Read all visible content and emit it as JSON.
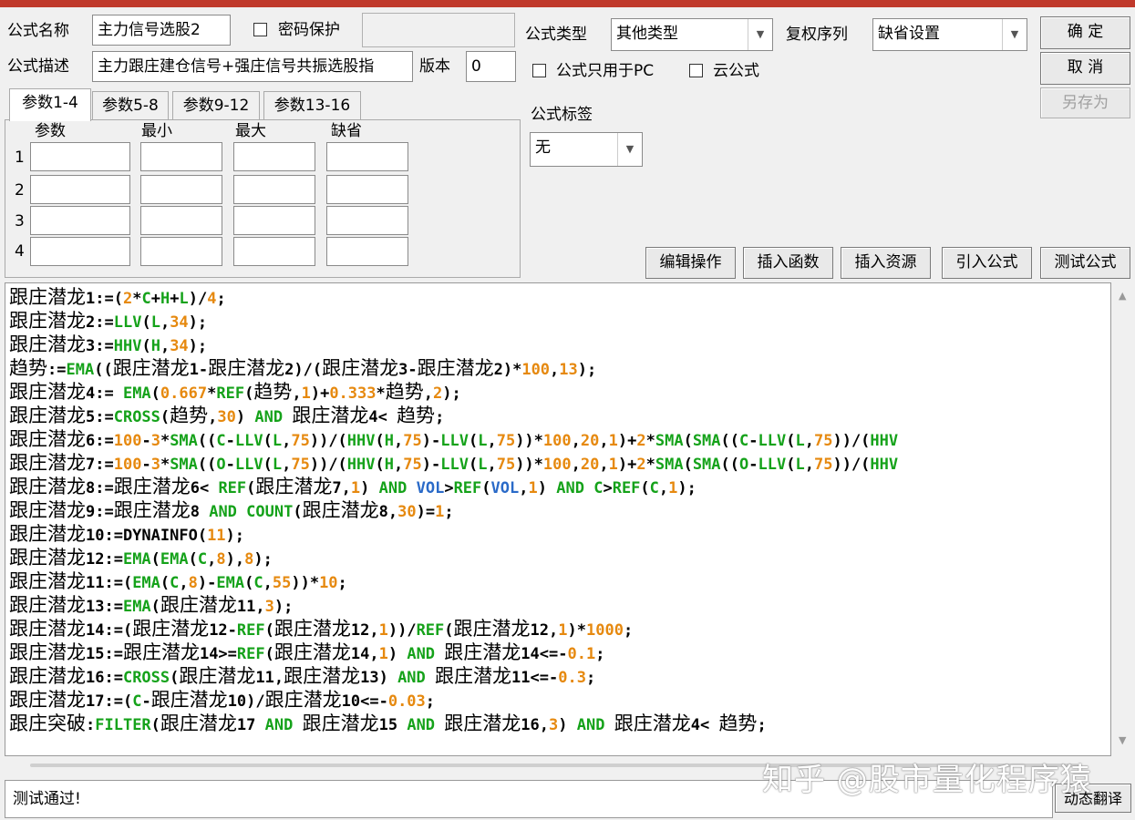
{
  "header": {
    "formula_name_label": "公式名称",
    "formula_name_value": "主力信号选股2",
    "password_label": "密码保护",
    "password_checked": false,
    "formula_desc_label": "公式描述",
    "formula_desc_value": "主力跟庄建仓信号+强庄信号共振选股指",
    "version_label": "版本",
    "version_value": "0",
    "formula_type_label": "公式类型",
    "formula_type_value": "其他类型",
    "rights_label": "复权序列",
    "rights_value": "缺省设置",
    "pc_only_label": "公式只用于PC",
    "pc_only_checked": false,
    "cloud_label": "云公式",
    "cloud_checked": false,
    "tag_label": "公式标签",
    "tag_value": "无"
  },
  "buttons": {
    "ok": "确 定",
    "cancel": "取 消",
    "save_as": "另存为",
    "edit_ops": "编辑操作",
    "insert_func": "插入函数",
    "insert_res": "插入资源",
    "import_formula": "引入公式",
    "test_formula": "测试公式",
    "dynamic_translate": "动态翻译"
  },
  "params": {
    "tabs": [
      "参数1-4",
      "参数5-8",
      "参数9-12",
      "参数13-16"
    ],
    "active_tab": 0,
    "columns": [
      "参数",
      "最小",
      "最大",
      "缺省"
    ],
    "rows": [
      "1",
      "2",
      "3",
      "4"
    ]
  },
  "code_lines": [
    [
      [
        "跟庄潜龙",
        "t"
      ],
      [
        "1:=(",
        ""
      ],
      [
        "2",
        "n"
      ],
      [
        "*",
        ""
      ],
      [
        "C",
        "f"
      ],
      [
        "+",
        ""
      ],
      [
        "H",
        "f"
      ],
      [
        "+",
        ""
      ],
      [
        "L",
        "f"
      ],
      [
        ")/",
        ""
      ],
      [
        "4",
        "n"
      ],
      [
        ";",
        ""
      ]
    ],
    [
      [
        "跟庄潜龙",
        "t"
      ],
      [
        "2:=",
        ""
      ],
      [
        "LLV",
        "f"
      ],
      [
        "(",
        ""
      ],
      [
        "L",
        "f"
      ],
      [
        ",",
        ""
      ],
      [
        "34",
        "n"
      ],
      [
        ");",
        ""
      ]
    ],
    [
      [
        "跟庄潜龙",
        "t"
      ],
      [
        "3:=",
        ""
      ],
      [
        "HHV",
        "f"
      ],
      [
        "(",
        ""
      ],
      [
        "H",
        "f"
      ],
      [
        ",",
        ""
      ],
      [
        "34",
        "n"
      ],
      [
        ");",
        ""
      ]
    ],
    [
      [
        "趋势",
        "t"
      ],
      [
        ":=",
        ""
      ],
      [
        "EMA",
        "f"
      ],
      [
        "((",
        ""
      ],
      [
        "跟庄潜龙",
        "t"
      ],
      [
        "1-",
        ""
      ],
      [
        "跟庄潜龙",
        "t"
      ],
      [
        "2)/(",
        ""
      ],
      [
        "跟庄潜龙",
        "t"
      ],
      [
        "3-",
        ""
      ],
      [
        "跟庄潜龙",
        "t"
      ],
      [
        "2)*",
        ""
      ],
      [
        "100",
        "n"
      ],
      [
        ",",
        ""
      ],
      [
        "13",
        "n"
      ],
      [
        ");",
        ""
      ]
    ],
    [
      [
        "跟庄潜龙",
        "t"
      ],
      [
        "4:= ",
        ""
      ],
      [
        "EMA",
        "f"
      ],
      [
        "(",
        ""
      ],
      [
        "0.667",
        "n"
      ],
      [
        "*",
        ""
      ],
      [
        "REF",
        "f"
      ],
      [
        "(",
        ""
      ],
      [
        "趋势",
        "t"
      ],
      [
        ",",
        ""
      ],
      [
        "1",
        "n"
      ],
      [
        ")+",
        ""
      ],
      [
        "0.333",
        "n"
      ],
      [
        "*",
        ""
      ],
      [
        "趋势",
        "t"
      ],
      [
        ",",
        ""
      ],
      [
        "2",
        "n"
      ],
      [
        ");",
        ""
      ]
    ],
    [
      [
        "跟庄潜龙",
        "t"
      ],
      [
        "5:=",
        ""
      ],
      [
        "CROSS",
        "f"
      ],
      [
        "(",
        ""
      ],
      [
        "趋势",
        "t"
      ],
      [
        ",",
        ""
      ],
      [
        "30",
        "n"
      ],
      [
        ") ",
        ""
      ],
      [
        "AND",
        "k"
      ],
      [
        " ",
        ""
      ],
      [
        "跟庄潜龙",
        "t"
      ],
      [
        "4< ",
        ""
      ],
      [
        "趋势",
        "t"
      ],
      [
        ";",
        ""
      ]
    ],
    [
      [
        "跟庄潜龙",
        "t"
      ],
      [
        "6:=",
        ""
      ],
      [
        "100",
        "n"
      ],
      [
        "-",
        ""
      ],
      [
        "3",
        "n"
      ],
      [
        "*",
        ""
      ],
      [
        "SMA",
        "f"
      ],
      [
        "((",
        ""
      ],
      [
        "C",
        "f"
      ],
      [
        "-",
        ""
      ],
      [
        "LLV",
        "f"
      ],
      [
        "(",
        ""
      ],
      [
        "L",
        "f"
      ],
      [
        ",",
        ""
      ],
      [
        "75",
        "n"
      ],
      [
        "))/(",
        ""
      ],
      [
        "HHV",
        "f"
      ],
      [
        "(",
        ""
      ],
      [
        "H",
        "f"
      ],
      [
        ",",
        ""
      ],
      [
        "75",
        "n"
      ],
      [
        ")-",
        ""
      ],
      [
        "LLV",
        "f"
      ],
      [
        "(",
        ""
      ],
      [
        "L",
        "f"
      ],
      [
        ",",
        ""
      ],
      [
        "75",
        "n"
      ],
      [
        "))*",
        ""
      ],
      [
        "100",
        "n"
      ],
      [
        ",",
        ""
      ],
      [
        "20",
        "n"
      ],
      [
        ",",
        ""
      ],
      [
        "1",
        "n"
      ],
      [
        ")+",
        ""
      ],
      [
        "2",
        "n"
      ],
      [
        "*",
        ""
      ],
      [
        "SMA",
        "f"
      ],
      [
        "(",
        ""
      ],
      [
        "SMA",
        "f"
      ],
      [
        "((",
        ""
      ],
      [
        "C",
        "f"
      ],
      [
        "-",
        ""
      ],
      [
        "LLV",
        "f"
      ],
      [
        "(",
        ""
      ],
      [
        "L",
        "f"
      ],
      [
        ",",
        ""
      ],
      [
        "75",
        "n"
      ],
      [
        "))/(",
        ""
      ],
      [
        "HHV",
        "f"
      ]
    ],
    [
      [
        "跟庄潜龙",
        "t"
      ],
      [
        "7:=",
        ""
      ],
      [
        "100",
        "n"
      ],
      [
        "-",
        ""
      ],
      [
        "3",
        "n"
      ],
      [
        "*",
        ""
      ],
      [
        "SMA",
        "f"
      ],
      [
        "((",
        ""
      ],
      [
        "O",
        "f"
      ],
      [
        "-",
        ""
      ],
      [
        "LLV",
        "f"
      ],
      [
        "(",
        ""
      ],
      [
        "L",
        "f"
      ],
      [
        ",",
        ""
      ],
      [
        "75",
        "n"
      ],
      [
        "))/(",
        ""
      ],
      [
        "HHV",
        "f"
      ],
      [
        "(",
        ""
      ],
      [
        "H",
        "f"
      ],
      [
        ",",
        ""
      ],
      [
        "75",
        "n"
      ],
      [
        ")-",
        ""
      ],
      [
        "LLV",
        "f"
      ],
      [
        "(",
        ""
      ],
      [
        "L",
        "f"
      ],
      [
        ",",
        ""
      ],
      [
        "75",
        "n"
      ],
      [
        "))*",
        ""
      ],
      [
        "100",
        "n"
      ],
      [
        ",",
        ""
      ],
      [
        "20",
        "n"
      ],
      [
        ",",
        ""
      ],
      [
        "1",
        "n"
      ],
      [
        ")+",
        ""
      ],
      [
        "2",
        "n"
      ],
      [
        "*",
        ""
      ],
      [
        "SMA",
        "f"
      ],
      [
        "(",
        ""
      ],
      [
        "SMA",
        "f"
      ],
      [
        "((",
        ""
      ],
      [
        "O",
        "f"
      ],
      [
        "-",
        ""
      ],
      [
        "LLV",
        "f"
      ],
      [
        "(",
        ""
      ],
      [
        "L",
        "f"
      ],
      [
        ",",
        ""
      ],
      [
        "75",
        "n"
      ],
      [
        "))/(",
        ""
      ],
      [
        "HHV",
        "f"
      ]
    ],
    [
      [
        "跟庄潜龙",
        "t"
      ],
      [
        "8:=",
        ""
      ],
      [
        "跟庄潜龙",
        "t"
      ],
      [
        "6< ",
        ""
      ],
      [
        "REF",
        "f"
      ],
      [
        "(",
        ""
      ],
      [
        "跟庄潜龙",
        "t"
      ],
      [
        "7,",
        ""
      ],
      [
        "1",
        "n"
      ],
      [
        ") ",
        ""
      ],
      [
        "AND",
        "k"
      ],
      [
        " ",
        ""
      ],
      [
        "VOL",
        "v"
      ],
      [
        ">",
        ""
      ],
      [
        "REF",
        "f"
      ],
      [
        "(",
        ""
      ],
      [
        "VOL",
        "v"
      ],
      [
        ",",
        ""
      ],
      [
        "1",
        "n"
      ],
      [
        ") ",
        ""
      ],
      [
        "AND",
        "k"
      ],
      [
        " ",
        ""
      ],
      [
        "C",
        "f"
      ],
      [
        ">",
        ""
      ],
      [
        "REF",
        "f"
      ],
      [
        "(",
        ""
      ],
      [
        "C",
        "f"
      ],
      [
        ",",
        ""
      ],
      [
        "1",
        "n"
      ],
      [
        ");",
        ""
      ]
    ],
    [
      [
        "跟庄潜龙",
        "t"
      ],
      [
        "9:=",
        ""
      ],
      [
        "跟庄潜龙",
        "t"
      ],
      [
        "8 ",
        ""
      ],
      [
        "AND",
        "k"
      ],
      [
        " ",
        ""
      ],
      [
        "COUNT",
        "f"
      ],
      [
        "(",
        ""
      ],
      [
        "跟庄潜龙",
        "t"
      ],
      [
        "8,",
        ""
      ],
      [
        "30",
        "n"
      ],
      [
        ")=",
        ""
      ],
      [
        "1",
        "n"
      ],
      [
        ";",
        ""
      ]
    ],
    [
      [
        "跟庄潜龙",
        "t"
      ],
      [
        "10:=DYNAINFO(",
        ""
      ],
      [
        "11",
        "n"
      ],
      [
        ");",
        ""
      ]
    ],
    [
      [
        "跟庄潜龙",
        "t"
      ],
      [
        "12:=",
        ""
      ],
      [
        "EMA",
        "f"
      ],
      [
        "(",
        ""
      ],
      [
        "EMA",
        "f"
      ],
      [
        "(",
        ""
      ],
      [
        "C",
        "f"
      ],
      [
        ",",
        ""
      ],
      [
        "8",
        "n"
      ],
      [
        "),",
        ""
      ],
      [
        "8",
        "n"
      ],
      [
        ");",
        ""
      ]
    ],
    [
      [
        "跟庄潜龙",
        "t"
      ],
      [
        "11:=(",
        ""
      ],
      [
        "EMA",
        "f"
      ],
      [
        "(",
        ""
      ],
      [
        "C",
        "f"
      ],
      [
        ",",
        ""
      ],
      [
        "8",
        "n"
      ],
      [
        ")-",
        ""
      ],
      [
        "EMA",
        "f"
      ],
      [
        "(",
        ""
      ],
      [
        "C",
        "f"
      ],
      [
        ",",
        ""
      ],
      [
        "55",
        "n"
      ],
      [
        "))*",
        ""
      ],
      [
        "10",
        "n"
      ],
      [
        ";",
        ""
      ]
    ],
    [
      [
        "跟庄潜龙",
        "t"
      ],
      [
        "13:=",
        ""
      ],
      [
        "EMA",
        "f"
      ],
      [
        "(",
        ""
      ],
      [
        "跟庄潜龙",
        "t"
      ],
      [
        "11,",
        ""
      ],
      [
        "3",
        "n"
      ],
      [
        ");",
        ""
      ]
    ],
    [
      [
        "跟庄潜龙",
        "t"
      ],
      [
        "14:=(",
        ""
      ],
      [
        "跟庄潜龙",
        "t"
      ],
      [
        "12-",
        ""
      ],
      [
        "REF",
        "f"
      ],
      [
        "(",
        ""
      ],
      [
        "跟庄潜龙",
        "t"
      ],
      [
        "12,",
        ""
      ],
      [
        "1",
        "n"
      ],
      [
        "))/",
        ""
      ],
      [
        "REF",
        "f"
      ],
      [
        "(",
        ""
      ],
      [
        "跟庄潜龙",
        "t"
      ],
      [
        "12,",
        ""
      ],
      [
        "1",
        "n"
      ],
      [
        ")*",
        ""
      ],
      [
        "1000",
        "n"
      ],
      [
        ";",
        ""
      ]
    ],
    [
      [
        "跟庄潜龙",
        "t"
      ],
      [
        "15:=",
        ""
      ],
      [
        "跟庄潜龙",
        "t"
      ],
      [
        "14>=",
        ""
      ],
      [
        "REF",
        "f"
      ],
      [
        "(",
        ""
      ],
      [
        "跟庄潜龙",
        "t"
      ],
      [
        "14,",
        ""
      ],
      [
        "1",
        "n"
      ],
      [
        ") ",
        ""
      ],
      [
        "AND",
        "k"
      ],
      [
        " ",
        ""
      ],
      [
        "跟庄潜龙",
        "t"
      ],
      [
        "14<=-",
        ""
      ],
      [
        "0.1",
        "n"
      ],
      [
        ";",
        ""
      ]
    ],
    [
      [
        "跟庄潜龙",
        "t"
      ],
      [
        "16:=",
        ""
      ],
      [
        "CROSS",
        "f"
      ],
      [
        "(",
        ""
      ],
      [
        "跟庄潜龙",
        "t"
      ],
      [
        "11,",
        ""
      ],
      [
        "跟庄潜龙",
        "t"
      ],
      [
        "13) ",
        ""
      ],
      [
        "AND",
        "k"
      ],
      [
        " ",
        ""
      ],
      [
        "跟庄潜龙",
        "t"
      ],
      [
        "11<=-",
        ""
      ],
      [
        "0.3",
        "n"
      ],
      [
        ";",
        ""
      ]
    ],
    [
      [
        "跟庄潜龙",
        "t"
      ],
      [
        "17:=(",
        ""
      ],
      [
        "C",
        "f"
      ],
      [
        "-",
        ""
      ],
      [
        "跟庄潜龙",
        "t"
      ],
      [
        "10)/",
        ""
      ],
      [
        "跟庄潜龙",
        "t"
      ],
      [
        "10<=-",
        ""
      ],
      [
        "0.03",
        "n"
      ],
      [
        ";",
        ""
      ]
    ],
    [
      [
        "跟庄突破",
        "t"
      ],
      [
        ":",
        ""
      ],
      [
        "FILTER",
        "f"
      ],
      [
        "(",
        ""
      ],
      [
        "跟庄潜龙",
        "t"
      ],
      [
        "17 ",
        ""
      ],
      [
        "AND",
        "k"
      ],
      [
        " ",
        ""
      ],
      [
        "跟庄潜龙",
        "t"
      ],
      [
        "15 ",
        ""
      ],
      [
        "AND",
        "k"
      ],
      [
        " ",
        ""
      ],
      [
        "跟庄潜龙",
        "t"
      ],
      [
        "16,",
        ""
      ],
      [
        "3",
        "n"
      ],
      [
        ") ",
        ""
      ],
      [
        "AND",
        "k"
      ],
      [
        " ",
        ""
      ],
      [
        "跟庄潜龙",
        "t"
      ],
      [
        "4< ",
        ""
      ],
      [
        "趋势",
        "t"
      ],
      [
        ";",
        ""
      ]
    ]
  ],
  "status_text": "测试通过!",
  "watermark": "知乎 @股市量化程序猿"
}
